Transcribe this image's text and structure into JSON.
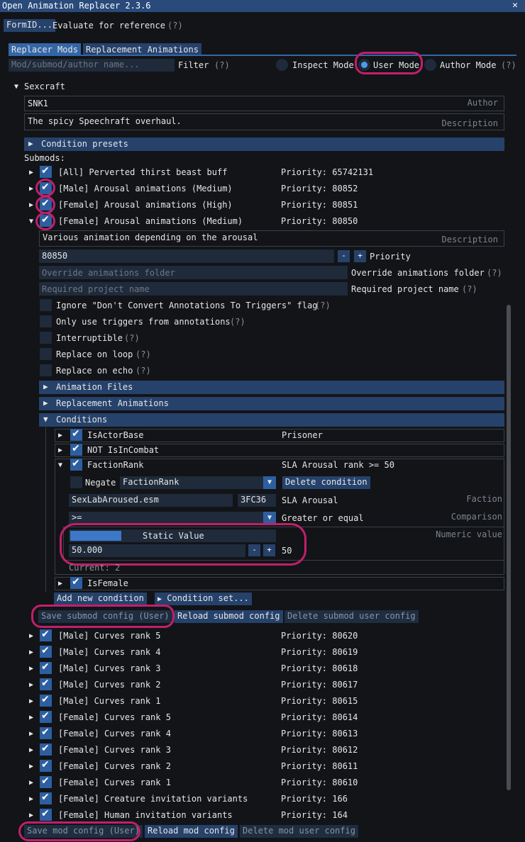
{
  "window": {
    "title": "Open Animation Replacer 2.3.6",
    "close": "✕"
  },
  "top": {
    "formid_btn": "FormID...",
    "evaluate_label": "Evaluate for reference",
    "help": "(?)"
  },
  "tabs": [
    "Replacer Mods",
    "Replacement Animations"
  ],
  "filter": {
    "placeholder": "Mod/submod/author name...",
    "label": "Filter",
    "help": "(?)"
  },
  "modes": {
    "inspect": "Inspect Mode",
    "user": "User Mode",
    "author": "Author Mode",
    "help": "(?)"
  },
  "mod": {
    "name": "Sexcraft",
    "author_value": "SNK1",
    "author_label": "Author",
    "description_value": "The spicy Speechraft overhaul.",
    "description_label": "Description",
    "condition_presets": "Condition presets",
    "submods_label": "Submods:"
  },
  "submods_top": [
    {
      "name": "[All] Perverted thirst beast buff",
      "priority": "Priority: 65742131"
    },
    {
      "name": "[Male] Arousal animations (Medium)",
      "priority": "Priority: 80852"
    },
    {
      "name": "[Female] Arousal animations (High)",
      "priority": "Priority: 80851"
    },
    {
      "name": "[Female] Arousal animations (Medium)",
      "priority": "Priority: 80850"
    }
  ],
  "open_submod": {
    "description_value": "Various animation depending on the arousal",
    "description_label": "Description",
    "priority_value": "80850",
    "minus": "-",
    "plus": "+",
    "priority_label": "Priority",
    "override_placeholder": "Override animations folder",
    "override_label": "Override animations folder",
    "override_help": "(?)",
    "project_placeholder": "Required project name",
    "project_label": "Required project name",
    "project_help": "(?)",
    "options": [
      {
        "label": "Ignore \"Don't Convert Annotations To Triggers\" flag",
        "help": "(?)"
      },
      {
        "label": "Only use triggers from annotations",
        "help": "(?)"
      },
      {
        "label": "Interruptible",
        "help": "(?)"
      },
      {
        "label": "Replace on loop",
        "help": "(?)"
      },
      {
        "label": "Replace on echo",
        "help": "(?)"
      }
    ],
    "sections": {
      "anim_files": "Animation Files",
      "replacement_anims": "Replacement Animations",
      "conditions": "Conditions"
    }
  },
  "conditions": {
    "c1": {
      "name": "IsActorBase",
      "value": "Prisoner"
    },
    "c2": {
      "name": "NOT IsInCombat"
    },
    "c3": {
      "name": "FactionRank",
      "summary": "SLA Arousal rank >= 50",
      "negate": "Negate",
      "type": "FactionRank",
      "delete": "Delete condition",
      "faction_file": "SexLabAroused.esm",
      "faction_id": "3FC36",
      "faction_name": "SLA Arousal",
      "faction_label": "Faction",
      "comparison_value": ">=",
      "comparison_text": "Greater or equal",
      "comparison_label": "Comparison",
      "numeric_mode": "Static Value",
      "numeric_label": "Numeric value",
      "numeric_input": "50.000",
      "numeric_display": "50",
      "current": "Current: 2"
    },
    "c4": {
      "name": "IsFemale"
    },
    "add": "Add new condition",
    "set": "Condition set..."
  },
  "submod_buttons": {
    "save": "Save submod config (User)",
    "reload": "Reload submod config",
    "delete": "Delete submod user config"
  },
  "submods_bottom": [
    {
      "name": "[Male] Curves rank 5",
      "priority": "Priority: 80620"
    },
    {
      "name": "[Male] Curves rank 4",
      "priority": "Priority: 80619"
    },
    {
      "name": "[Male] Curves rank 3",
      "priority": "Priority: 80618"
    },
    {
      "name": "[Male] Curves rank 2",
      "priority": "Priority: 80617"
    },
    {
      "name": "[Male] Curves rank 1",
      "priority": "Priority: 80615"
    },
    {
      "name": "[Female] Curves rank 5",
      "priority": "Priority: 80614"
    },
    {
      "name": "[Female] Curves rank 4",
      "priority": "Priority: 80613"
    },
    {
      "name": "[Female] Curves rank 3",
      "priority": "Priority: 80612"
    },
    {
      "name": "[Female] Curves rank 2",
      "priority": "Priority: 80611"
    },
    {
      "name": "[Female] Curves rank 1",
      "priority": "Priority: 80610"
    },
    {
      "name": "[Female] Creature invitation variants",
      "priority": "Priority: 166"
    },
    {
      "name": "[Female] Human invitation variants",
      "priority": "Priority: 164"
    }
  ],
  "mod_buttons": {
    "save": "Save mod config (User)",
    "reload": "Reload mod config",
    "delete": "Delete mod user config"
  },
  "colors": {
    "accent": "#3466a6",
    "highlight": "#c21f6b",
    "header": "#26426b"
  }
}
